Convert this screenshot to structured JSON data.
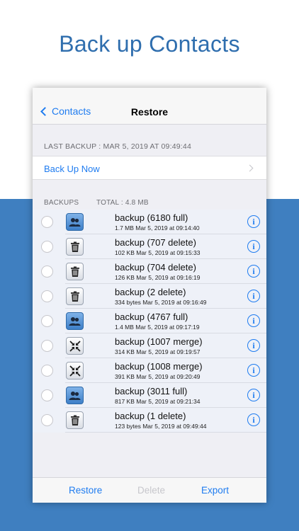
{
  "headline": "Back up Contacts",
  "nav": {
    "back_label": "Contacts",
    "title": "Restore"
  },
  "last_backup": "LAST BACKUP : MAR 5, 2019 AT 09:49:44",
  "backup_now": "Back Up Now",
  "backups_header": {
    "label": "BACKUPS",
    "total": "TOTAL : 4.8 MB"
  },
  "backups": [
    {
      "icon": "contacts-icon",
      "kind": "full",
      "title": "backup (6180 full)",
      "sub": "1.7 MB  Mar 5, 2019 at 09:14:40"
    },
    {
      "icon": "trash-icon",
      "kind": "delete",
      "title": "backup (707 delete)",
      "sub": "102 KB  Mar 5, 2019 at 09:15:33"
    },
    {
      "icon": "trash-icon",
      "kind": "delete",
      "title": "backup (704 delete)",
      "sub": "126 KB  Mar 5, 2019 at 09:16:19"
    },
    {
      "icon": "trash-icon",
      "kind": "delete",
      "title": "backup (2 delete)",
      "sub": "334 bytes  Mar 5, 2019 at 09:16:49"
    },
    {
      "icon": "contacts-icon",
      "kind": "full",
      "title": "backup (4767 full)",
      "sub": "1.4 MB  Mar 5, 2019 at 09:17:19"
    },
    {
      "icon": "merge-icon",
      "kind": "merge",
      "title": "backup (1007 merge)",
      "sub": "314 KB  Mar 5, 2019 at 09:19:57"
    },
    {
      "icon": "merge-icon",
      "kind": "merge",
      "title": "backup (1008 merge)",
      "sub": "391 KB  Mar 5, 2019 at 09:20:49"
    },
    {
      "icon": "contacts-icon",
      "kind": "full",
      "title": "backup (3011 full)",
      "sub": "817 KB  Mar 5, 2019 at 09:21:34"
    },
    {
      "icon": "trash-icon",
      "kind": "delete",
      "title": "backup (1 delete)",
      "sub": "123 bytes  Mar 5, 2019 at 09:49:44"
    }
  ],
  "toolbar": {
    "restore": "Restore",
    "delete": "Delete",
    "export": "Export"
  },
  "colors": {
    "accent": "#1f7cf0",
    "disabled": "#c7c7cc",
    "background_band": "#3f7fc0",
    "headline": "#2f6eae"
  }
}
